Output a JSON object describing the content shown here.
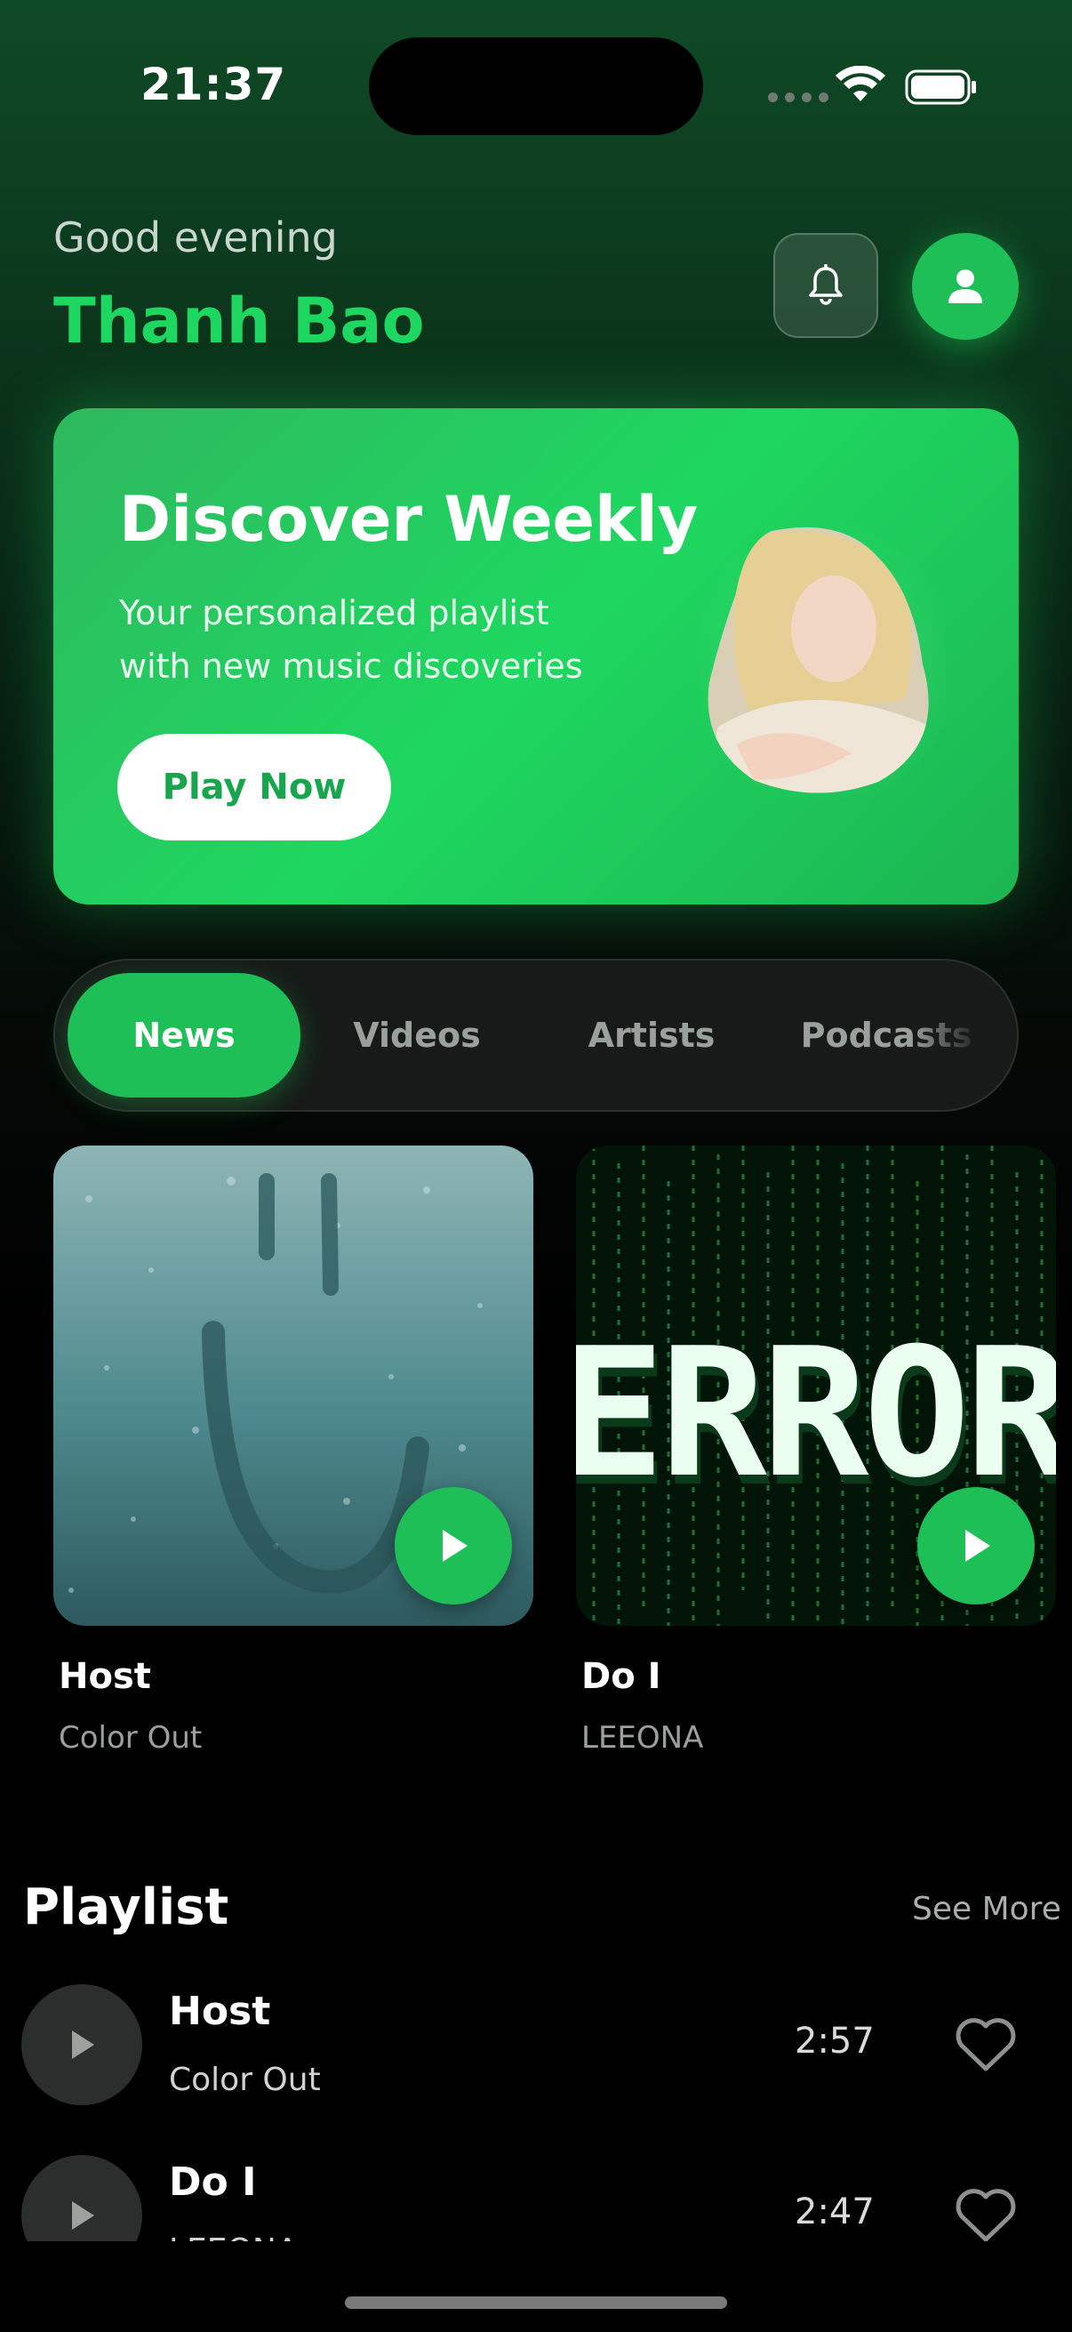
{
  "status_bar": {
    "time": "21:37"
  },
  "header": {
    "greeting": "Good evening",
    "user_name": "Thanh Bao"
  },
  "discover": {
    "title": "Discover Weekly",
    "subtitle": "Your personalized playlist with new music discoveries",
    "button_label": "Play Now"
  },
  "tabs": [
    {
      "label": "News",
      "active": true
    },
    {
      "label": "Videos",
      "active": false
    },
    {
      "label": "Artists",
      "active": false
    },
    {
      "label": "Podcasts",
      "active": false
    }
  ],
  "featured": [
    {
      "title": "Host",
      "artist": "Color Out",
      "cover_text": ""
    },
    {
      "title": "Do I",
      "artist": "LEEONA",
      "cover_text": "ERROR"
    }
  ],
  "playlist": {
    "heading": "Playlist",
    "see_more_label": "See More",
    "items": [
      {
        "title": "Host",
        "artist": "Color Out",
        "duration": "2:57"
      },
      {
        "title": "Do I",
        "artist": "LEEONA",
        "duration": "2:47"
      }
    ]
  },
  "colors": {
    "accent": "#1ed760",
    "background": "#000000",
    "card_bg": "#171a18"
  }
}
